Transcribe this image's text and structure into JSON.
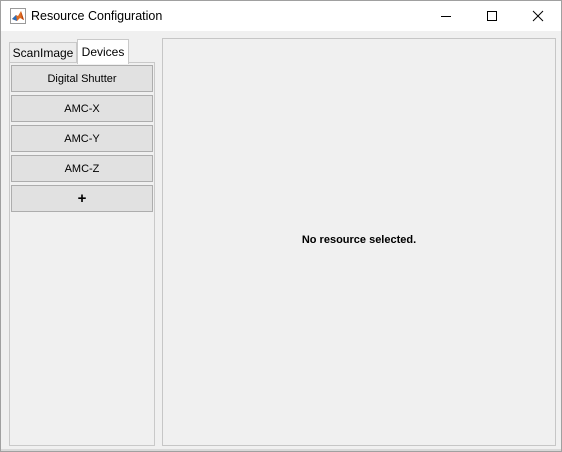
{
  "window": {
    "title": "Resource Configuration"
  },
  "tabs": [
    {
      "label": "ScanImage",
      "selected": false
    },
    {
      "label": "Devices",
      "selected": true
    }
  ],
  "devices": {
    "buttons": [
      {
        "label": "Digital Shutter"
      },
      {
        "label": "AMC-X"
      },
      {
        "label": "AMC-Y"
      },
      {
        "label": "AMC-Z"
      }
    ],
    "add_label": "+"
  },
  "detail": {
    "message": "No resource selected."
  }
}
